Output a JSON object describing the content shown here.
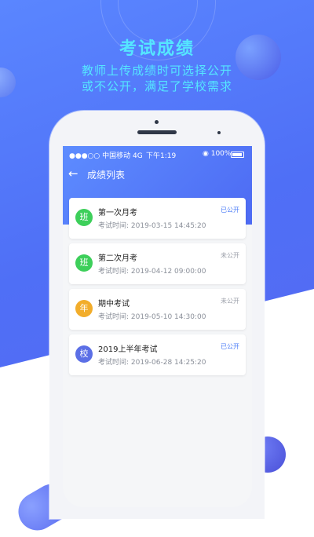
{
  "promo": {
    "title": "考试成绩",
    "line1": "教师上传成绩时可选择公开",
    "line2": "或不公开，满足了学校需求"
  },
  "status_bar": {
    "carrier": "●●●○○ 中国移动  4G",
    "time": "下午1:19",
    "battery": "◉ 100%"
  },
  "nav": {
    "back_icon": "←",
    "title": "成绩列表"
  },
  "colors": {
    "public_status": "#4a7bf7",
    "private_status": "#9a9ea8"
  },
  "exams": [
    {
      "badge": "班",
      "badge_color": "#3dcf5a",
      "title": "第一次月考",
      "time": "考试时间:  2019-03-15    14:45:20",
      "status": "已公开",
      "public": true
    },
    {
      "badge": "班",
      "badge_color": "#3dcf5a",
      "title": "第二次月考",
      "time": "考试时间:  2019-04-12    09:00:00",
      "status": "未公开",
      "public": false
    },
    {
      "badge": "年",
      "badge_color": "#f2ad2b",
      "title": "期中考试",
      "time": "考试时间:  2019-05-10    14:30:00",
      "status": "未公开",
      "public": false
    },
    {
      "badge": "校",
      "badge_color": "#5b6fe6",
      "title": "2019上半年考试",
      "time": "考试时间:  2019-06-28    14:25:20",
      "status": "已公开",
      "public": true
    }
  ]
}
